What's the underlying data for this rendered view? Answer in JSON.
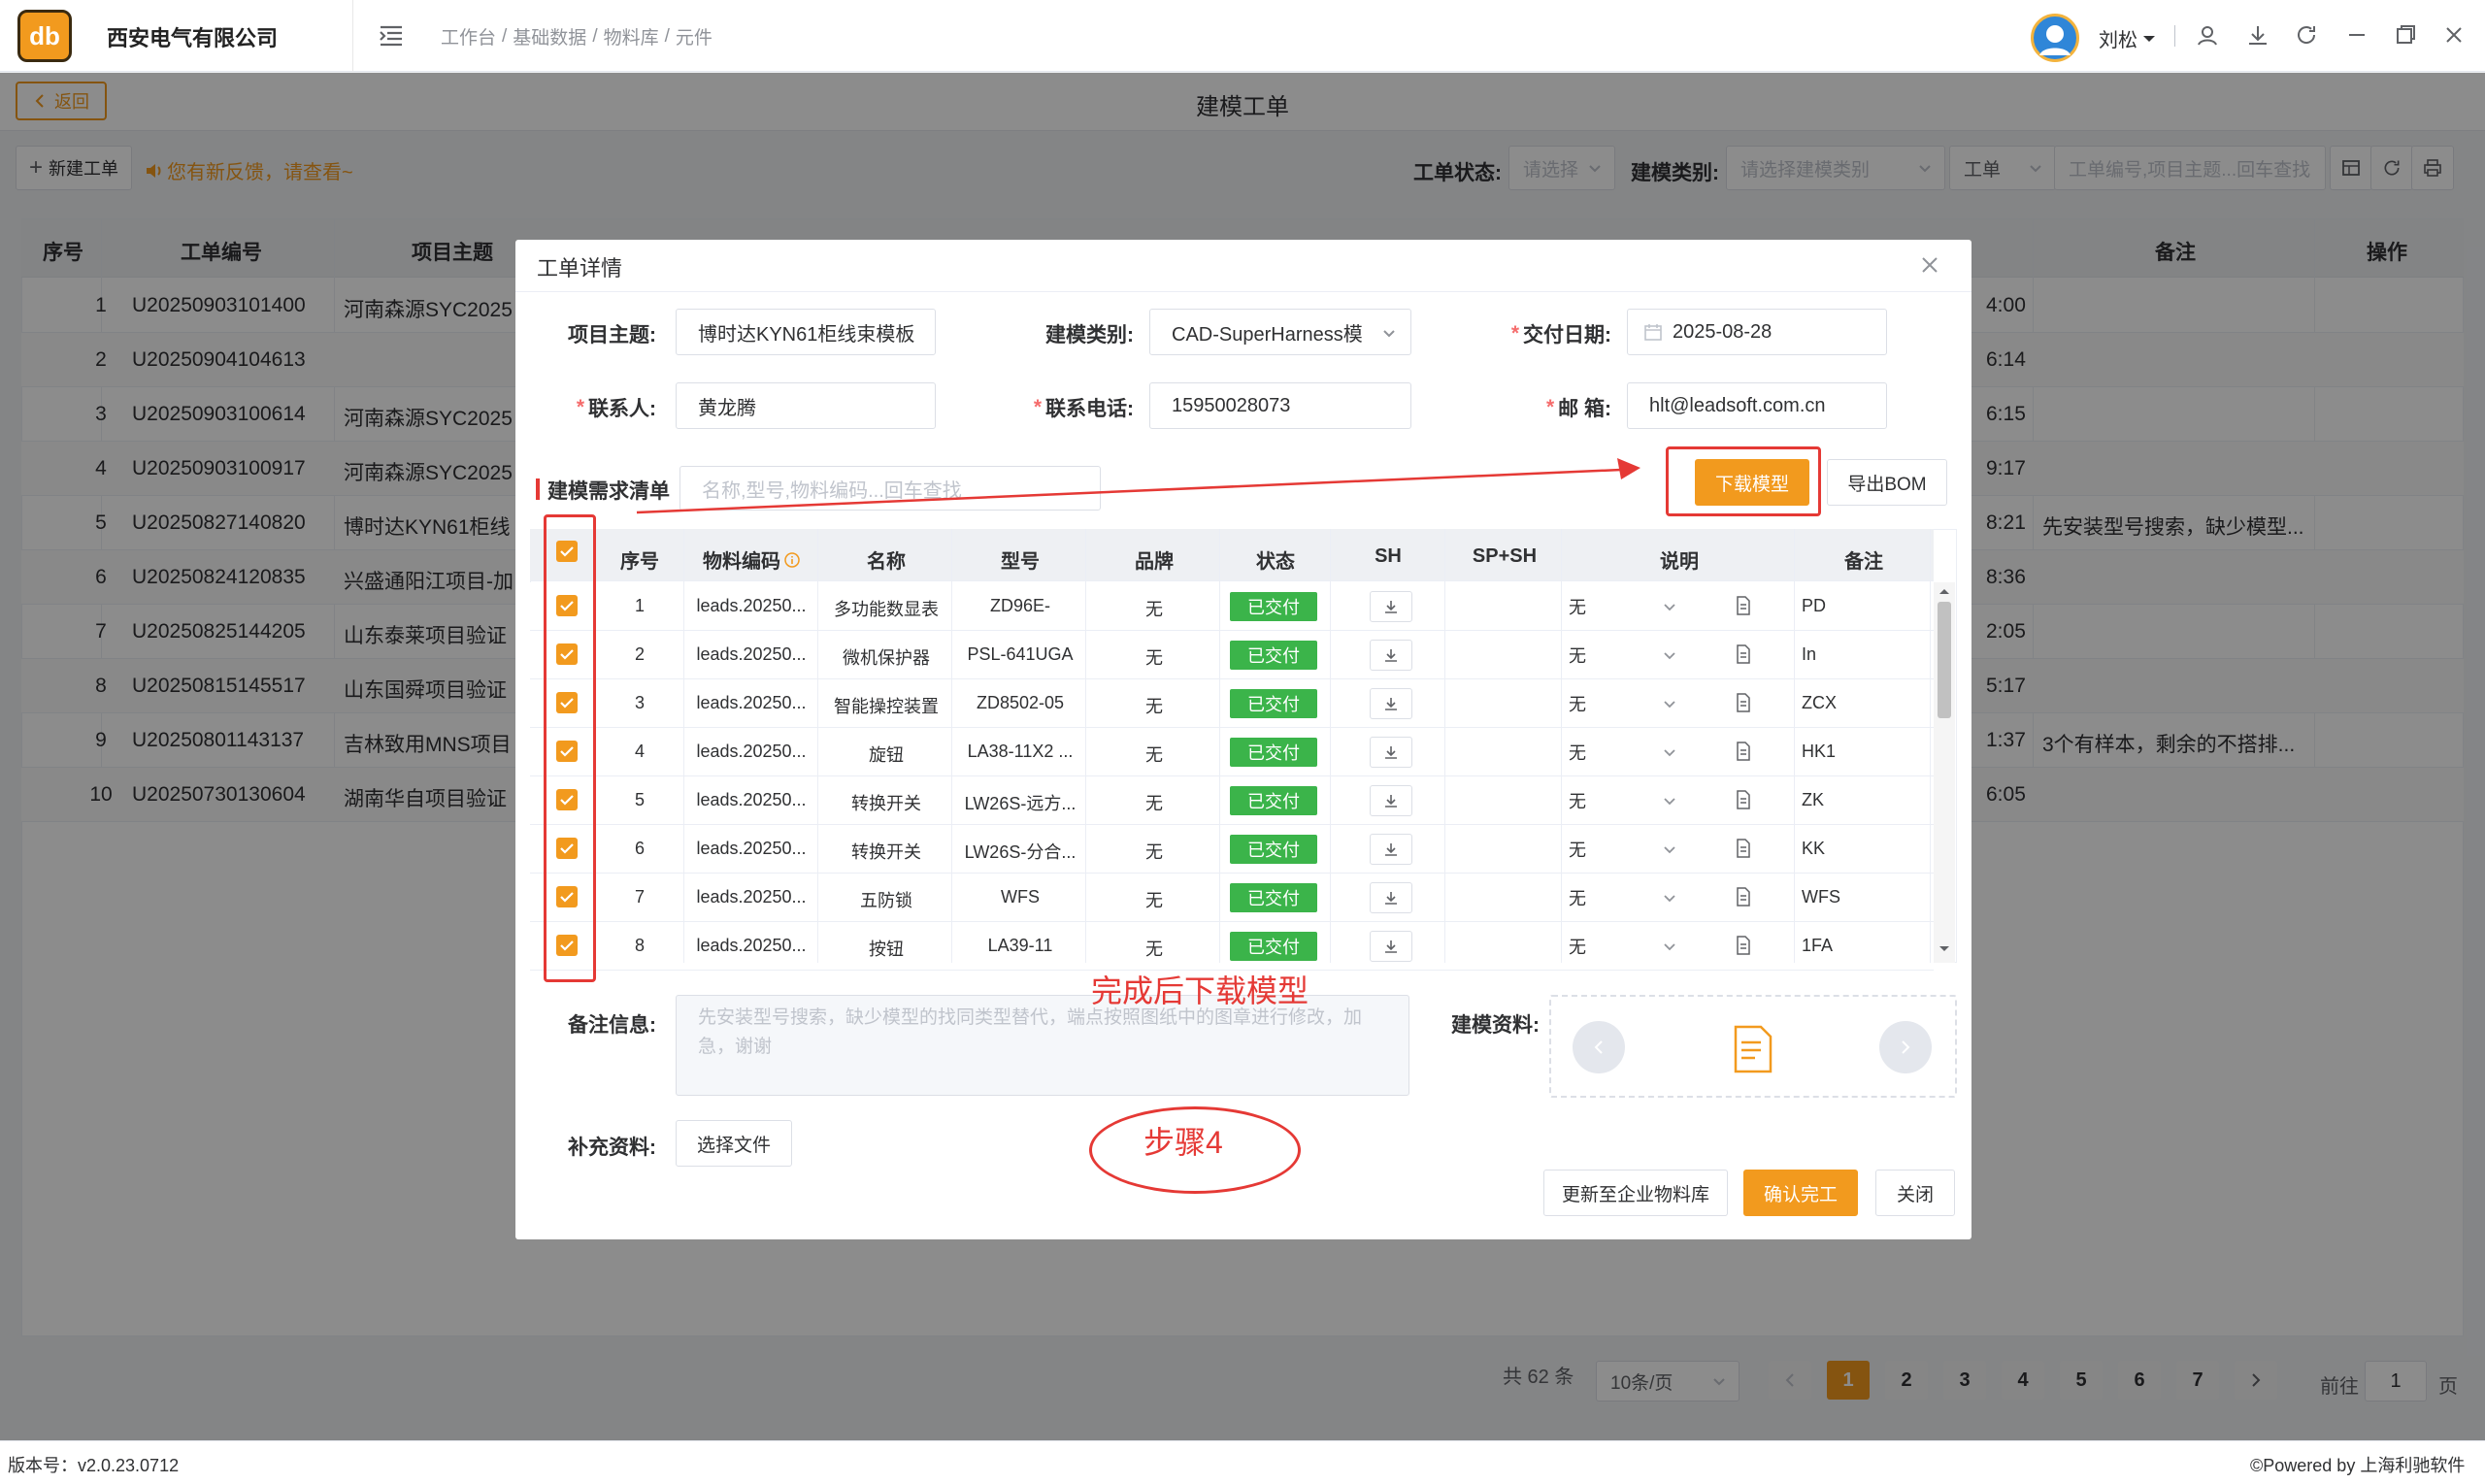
{
  "app": {
    "company": "西安电气有限公司",
    "logo_text": "db",
    "user": "刘松"
  },
  "breadcrumb": [
    "工作台",
    "/",
    "基础数据",
    "/",
    "物料库",
    "/",
    "元件"
  ],
  "icons": {
    "menu": "menu-fold-icon",
    "user": "user-center-icon",
    "download": "download-icon",
    "refresh": "refresh-icon",
    "minimize": "minimize-icon",
    "maximize": "maximize-icon",
    "close": "close-icon"
  },
  "header": {
    "back": "返回",
    "title": "建模工单"
  },
  "toolbar": {
    "new_order": "新建工单",
    "notice": "您有新反馈，请查看~",
    "status_label": "工单状态:",
    "status_placeholder": "请选择",
    "category_label": "建模类别:",
    "category_placeholder": "请选择建模类别",
    "type_select": "工单",
    "search_placeholder": "工单编号,项目主题...回车查找"
  },
  "bg_table": {
    "headers": [
      "序号",
      "工单编号",
      "项目主题",
      "备注",
      "操作"
    ],
    "rows": [
      {
        "no": "1",
        "code": "U20250903101400",
        "topic": "河南森源SYC2025",
        "time": "4:00",
        "remark": ""
      },
      {
        "no": "2",
        "code": "U20250904104613",
        "topic": "",
        "time": "6:14",
        "remark": ""
      },
      {
        "no": "3",
        "code": "U20250903100614",
        "topic": "河南森源SYC2025",
        "time": "6:15",
        "remark": ""
      },
      {
        "no": "4",
        "code": "U20250903100917",
        "topic": "河南森源SYC2025",
        "time": "9:17",
        "remark": ""
      },
      {
        "no": "5",
        "code": "U20250827140820",
        "topic": "博时达KYN61柜线",
        "time": "8:21",
        "remark": "先安装型号搜索，缺少模型..."
      },
      {
        "no": "6",
        "code": "U20250824120835",
        "topic": "兴盛通阳江项目-加",
        "time": "8:36",
        "remark": ""
      },
      {
        "no": "7",
        "code": "U20250825144205",
        "topic": "山东泰莱项目验证",
        "time": "2:05",
        "remark": ""
      },
      {
        "no": "8",
        "code": "U20250815145517",
        "topic": "山东国舜项目验证",
        "time": "5:17",
        "remark": ""
      },
      {
        "no": "9",
        "code": "U20250801143137",
        "topic": "吉林致用MNS项目",
        "time": "1:37",
        "remark": "3个有样本，剩余的不搭排..."
      },
      {
        "no": "10",
        "code": "U20250730130604",
        "topic": "湖南华自项目验证",
        "time": "6:05",
        "remark": ""
      }
    ]
  },
  "pagination": {
    "total": "共 62 条",
    "page_size": "10条/页",
    "pages": [
      "1",
      "2",
      "3",
      "4",
      "5",
      "6",
      "7"
    ],
    "current": "1",
    "goto_label": "前往",
    "goto_value": "1",
    "goto_suffix": "页"
  },
  "footer": {
    "version": "版本号：v2.0.23.0712",
    "powered": "©Powered by 上海利驰软件"
  },
  "dialog": {
    "title": "工单详情",
    "project_label": "项目主题:",
    "project_value": "博时达KYN61柜线束模板",
    "category_label": "建模类别:",
    "category_value": "CAD-SuperHarness模",
    "delivery_label": "交付日期:",
    "delivery_value": "2025-08-28",
    "contact_label": "联系人:",
    "contact_value": "黄龙腾",
    "phone_label": "联系电话:",
    "phone_value": "15950028073",
    "email_label": "邮 箱:",
    "email_value": "hlt@leadsoft.com.cn",
    "list_label": "建模需求清单",
    "list_search_placeholder": "名称,型号,物料编码...回车查找",
    "download_model": "下载模型",
    "export_bom": "导出BOM",
    "table_headers": [
      "序号",
      "物料编码",
      "名称",
      "型号",
      "品牌",
      "状态",
      "SH",
      "SP+SH",
      "说明",
      "备注"
    ],
    "rows": [
      {
        "no": "1",
        "code": "leads.20250...",
        "name": "多功能数显表",
        "model": "ZD96E-",
        "brand": "无",
        "status": "已交付",
        "desc": "无",
        "remark": "PD"
      },
      {
        "no": "2",
        "code": "leads.20250...",
        "name": "微机保护器",
        "model": "PSL-641UGA",
        "brand": "无",
        "status": "已交付",
        "desc": "无",
        "remark": "In"
      },
      {
        "no": "3",
        "code": "leads.20250...",
        "name": "智能操控装置",
        "model": "ZD8502-05",
        "brand": "无",
        "status": "已交付",
        "desc": "无",
        "remark": "ZCX"
      },
      {
        "no": "4",
        "code": "leads.20250...",
        "name": "旋钮",
        "model": "LA38-11X2 ...",
        "brand": "无",
        "status": "已交付",
        "desc": "无",
        "remark": "HK1"
      },
      {
        "no": "5",
        "code": "leads.20250...",
        "name": "转换开关",
        "model": "LW26S-远方...",
        "brand": "无",
        "status": "已交付",
        "desc": "无",
        "remark": "ZK"
      },
      {
        "no": "6",
        "code": "leads.20250...",
        "name": "转换开关",
        "model": "LW26S-分合...",
        "brand": "无",
        "status": "已交付",
        "desc": "无",
        "remark": "KK"
      },
      {
        "no": "7",
        "code": "leads.20250...",
        "name": "五防锁",
        "model": "WFS",
        "brand": "无",
        "status": "已交付",
        "desc": "无",
        "remark": "WFS"
      },
      {
        "no": "8",
        "code": "leads.20250...",
        "name": "按钮",
        "model": "LA39-11",
        "brand": "无",
        "status": "已交付",
        "desc": "无",
        "remark": "1FA"
      }
    ],
    "note_label": "备注信息:",
    "note_value": "先安装型号搜索，缺少模型的找同类型替代，端点按照图纸中的图章进行修改，加急，谢谢",
    "material_label": "建模资料:",
    "supplement_label": "补充资料:",
    "choose_file": "选择文件",
    "update_library": "更新至企业物料库",
    "confirm_done": "确认完工",
    "close": "关闭"
  },
  "annotations": {
    "after_done": "完成后下载模型",
    "step": "步骤4",
    "color": "#e53935"
  },
  "colors": {
    "accent": "#f29a1e",
    "success": "#3bb44a",
    "annotation": "#e53935"
  }
}
